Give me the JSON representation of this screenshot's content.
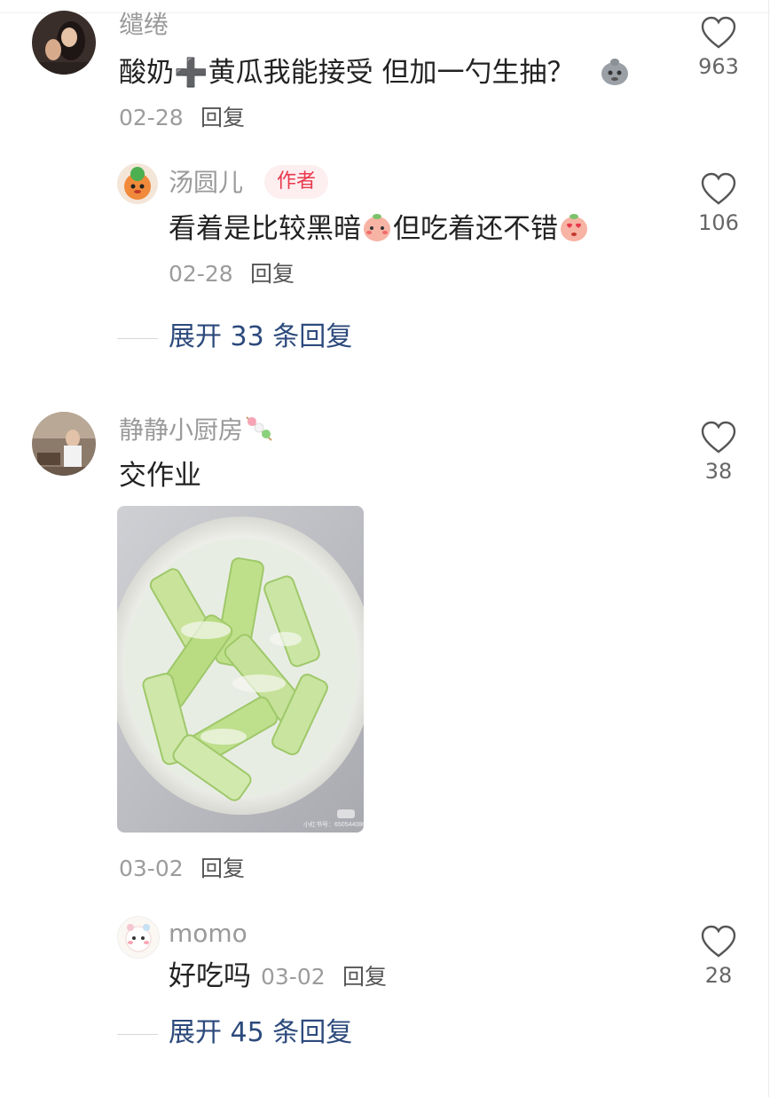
{
  "comments": [
    {
      "username": "缱绻",
      "text": "酸奶➕黄瓜我能接受 但加一勺生抽？",
      "date": "02-28",
      "reply_label": "回复",
      "likes": "963",
      "emoji": "thinking-sticker-icon"
    },
    {
      "username": "汤圆儿",
      "author_tag": "作者",
      "text_a": "看着是比较黑暗",
      "text_b": "但吃着还不错",
      "date": "02-28",
      "reply_label": "回复",
      "likes": "106"
    },
    {
      "username": "静静小厨房",
      "text": "交作业",
      "date": "03-02",
      "reply_label": "回复",
      "likes": "38",
      "photo_watermark": "小红书号：6505440869"
    },
    {
      "username": "momo",
      "text": "好吃吗",
      "date": "03-02",
      "reply_label": "回复",
      "likes": "28"
    }
  ],
  "expand_1": "展开 33 条回复",
  "expand_2": "展开 45 条回复",
  "colors": {
    "accent_link": "#2c4a7c",
    "author_tag_bg": "#fdeef0",
    "author_tag_text": "#e8394d"
  }
}
